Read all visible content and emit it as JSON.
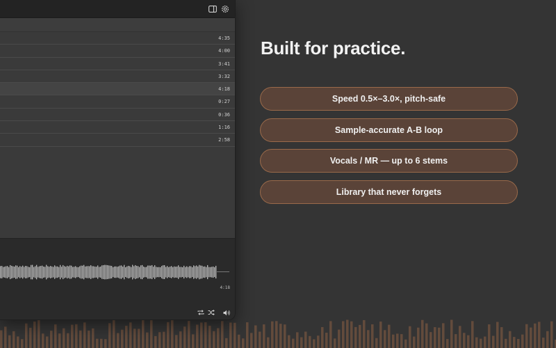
{
  "window": {
    "titlebar": {
      "sidebar_toggle_icon": "sidebar-toggle-icon",
      "settings_icon": "gear-icon"
    },
    "tracks": [
      {
        "duration": "4:35",
        "selected": false
      },
      {
        "duration": "4:00",
        "selected": false
      },
      {
        "duration": "3:41",
        "selected": false
      },
      {
        "duration": "3:32",
        "selected": false
      },
      {
        "duration": "4:18",
        "selected": true
      },
      {
        "duration": "0:27",
        "selected": false
      },
      {
        "duration": "0:36",
        "selected": false
      },
      {
        "duration": "1:16",
        "selected": false
      },
      {
        "duration": "2:58",
        "selected": false
      }
    ],
    "player": {
      "total_time": "4:18",
      "controls": [
        "repeat-icon",
        "shuffle-icon",
        "volume-icon"
      ]
    }
  },
  "hero": {
    "title": "Built for practice."
  },
  "features": [
    {
      "label": "Speed 0.5×–3.0×, pitch-safe"
    },
    {
      "label": "Sample-accurate A-B loop"
    },
    {
      "label": "Vocals / MR — up to 6 stems"
    },
    {
      "label": "Library that never forgets"
    }
  ],
  "colors": {
    "background": "#343434",
    "pill_fill": "#5a4338",
    "pill_border": "#9a6a4a",
    "bar_accent": "#8a5e44"
  }
}
